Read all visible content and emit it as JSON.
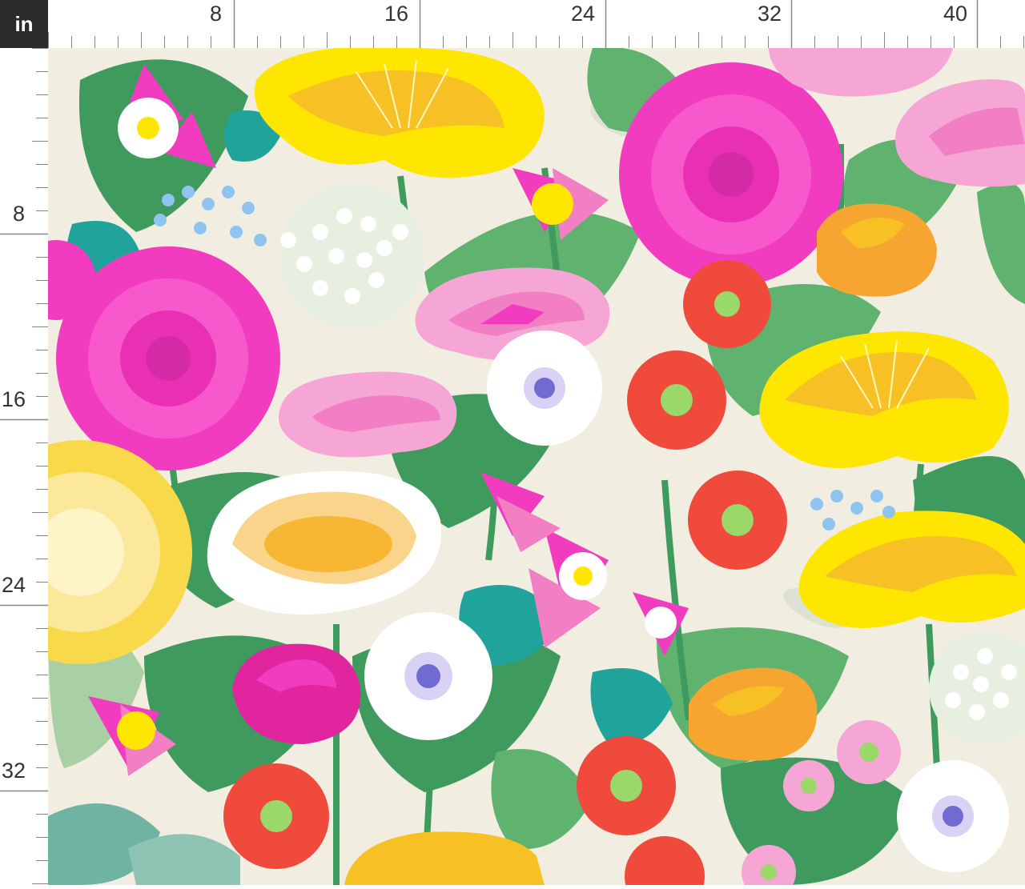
{
  "ruler": {
    "unit": "in",
    "top_labels": [
      "8",
      "16",
      "24",
      "32",
      "40"
    ],
    "left_labels": [
      "8",
      "16",
      "24",
      "32"
    ]
  },
  "colors": {
    "background": "#f2ede1",
    "leaf_dark": "#3f9b5d",
    "leaf_mid": "#5fb36f",
    "leaf_light": "#a9cfa5",
    "teal": "#1fa39a",
    "magenta": "#f23cbf",
    "pink_light": "#f5a6d4",
    "yellow": "#ffe600",
    "orange": "#f7a531",
    "red": "#ef4a3c",
    "white": "#ffffff",
    "periwinkle": "#6f6bd1"
  },
  "pattern": {
    "motifs": [
      "pink-dahlia",
      "yellow-poppy",
      "pink-poppy",
      "white-poppy",
      "red-daisy",
      "white-anemone",
      "pink-columbine",
      "queen-annes-lace",
      "forget-me-not",
      "orange-ranunculus",
      "pink-peony",
      "yellow-dahlia",
      "pink-daisy"
    ]
  }
}
